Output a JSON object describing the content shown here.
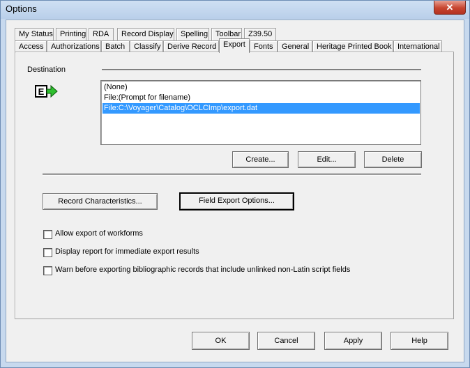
{
  "window": {
    "title": "Options",
    "close_glyph": "✕"
  },
  "tabs": {
    "row1": [
      "My Status",
      "Printing",
      "RDA",
      "Record Display",
      "Spelling",
      "Toolbar",
      "Z39.50"
    ],
    "row2": [
      "Access",
      "Authorizations",
      "Batch",
      "Classify",
      "Derive Record",
      "Export",
      "Fonts",
      "General",
      "Heritage Printed Book",
      "International"
    ],
    "active": "Export"
  },
  "destination": {
    "label": "Destination",
    "icon": "export-e-arrow-icon",
    "icon_letter": "E",
    "items": [
      "(None)",
      "File:(Prompt for filename)",
      "File:C:\\Voyager\\Catalog\\OCLCImp\\export.dat"
    ],
    "selected_index": 2,
    "buttons": {
      "create": "Create...",
      "edit": "Edit...",
      "delete": "Delete"
    }
  },
  "actions": {
    "record_characteristics": "Record Characteristics...",
    "field_export_options": "Field Export Options..."
  },
  "options": [
    {
      "label": "Allow export of workforms",
      "checked": false
    },
    {
      "label": "Display report for immediate export results",
      "checked": false
    },
    {
      "label": "Warn before exporting bibliographic records that include unlinked non-Latin script fields",
      "checked": false
    }
  ],
  "footer": {
    "ok": "OK",
    "cancel": "Cancel",
    "apply": "Apply",
    "help": "Help"
  },
  "colors": {
    "selection": "#3399ff",
    "arrow_green": "#2fbf2f"
  }
}
